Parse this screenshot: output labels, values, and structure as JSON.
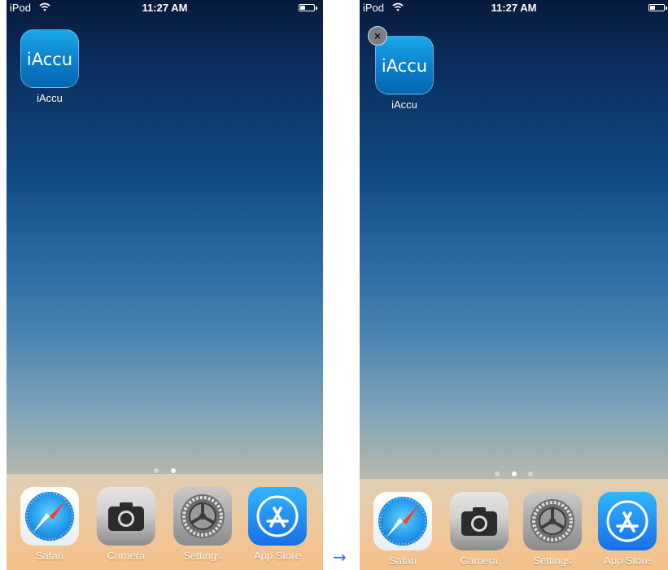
{
  "left_screen": {
    "status": {
      "device": "iPod",
      "time": "11:27 AM"
    },
    "home_app": {
      "icon_text": "iAccu",
      "label": "iAccu"
    },
    "page_dots": {
      "count": 2,
      "active_index": 1
    },
    "dock": [
      {
        "label": "Safari",
        "icon": "safari-icon"
      },
      {
        "label": "Camera",
        "icon": "camera-icon"
      },
      {
        "label": "Settings",
        "icon": "settings-icon"
      },
      {
        "label": "App Store",
        "icon": "app-store-icon"
      }
    ]
  },
  "right_screen": {
    "status": {
      "device": "iPod",
      "time": "11:27 AM"
    },
    "home_app": {
      "icon_text": "iAccu",
      "label": "iAccu",
      "delete_glyph": "×"
    },
    "page_dots": {
      "count": 3,
      "active_index": 1
    },
    "dock": [
      {
        "label": "Safari",
        "icon": "safari-icon"
      },
      {
        "label": "Camera",
        "icon": "camera-icon"
      },
      {
        "label": "Settings",
        "icon": "settings-icon"
      },
      {
        "label": "App Store",
        "icon": "app-store-icon"
      }
    ]
  },
  "transition_arrow": "→",
  "colors": {
    "brand_blue": "#0b7ecb",
    "frame_accent": "#5c84c6",
    "arrow": "#3b6fc5"
  }
}
